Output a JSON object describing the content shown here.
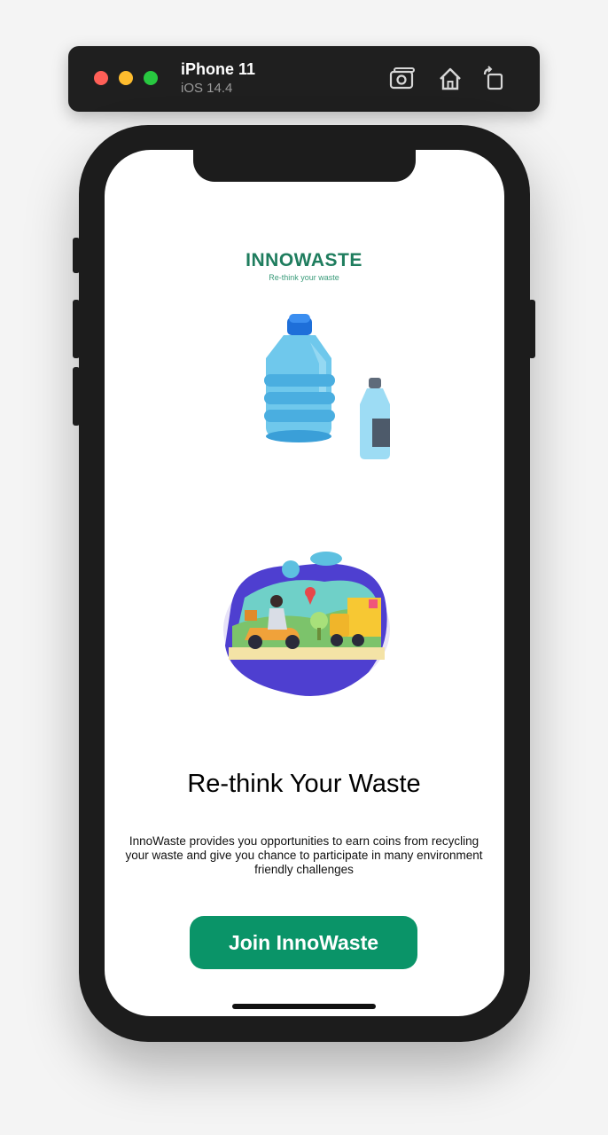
{
  "simulator": {
    "device_name": "iPhone 11",
    "os_version": "iOS 14.4",
    "icons": [
      "screenshot-icon",
      "home-icon",
      "rotate-icon"
    ]
  },
  "logo": {
    "wordmark": "INNOWASTE",
    "tagline": "Re-think your waste"
  },
  "onboarding": {
    "title": "Re-think Your Waste",
    "description": "InnoWaste provides you opportunities to earn coins from recycling your waste and give you chance to participate in many environment friendly challenges",
    "cta_label": "Join InnoWaste"
  },
  "colors": {
    "brand_green": "#0a9468",
    "logo_green": "#1f7d5e",
    "bottle_blue": "#6fc8ec",
    "cap_blue": "#1e6fd9"
  }
}
